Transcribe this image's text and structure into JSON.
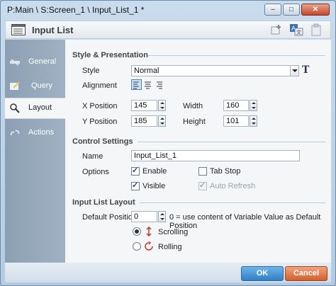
{
  "window": {
    "title": "P:Main \\ S:Screen_1 \\ Input_List_1 *"
  },
  "header": {
    "title": "Input List"
  },
  "sidebar": {
    "items": [
      {
        "label": "General",
        "icon": "general-icon"
      },
      {
        "label": "Layout",
        "icon": "layout-icon"
      },
      {
        "label": "Actions",
        "icon": "actions-icon"
      },
      {
        "label": "Query",
        "icon": "query-icon"
      }
    ],
    "selected": "Layout"
  },
  "style_presentation": {
    "section_title": "Style & Presentation",
    "style_label": "Style",
    "style_value": "Normal",
    "alignment_label": "Alignment",
    "x_label": "X Position",
    "x_value": "145",
    "y_label": "Y Position",
    "y_value": "185",
    "width_label": "Width",
    "width_value": "160",
    "height_label": "Height",
    "height_value": "101"
  },
  "control_settings": {
    "section_title": "Control Settings",
    "name_label": "Name",
    "name_value": "Input_List_1",
    "options_label": "Options",
    "enable_label": "Enable",
    "tabstop_label": "Tab Stop",
    "visible_label": "Visible",
    "autorefresh_label": "Auto Refresh"
  },
  "input_list_layout": {
    "section_title": "Input List Layout",
    "default_position_label": "Default Position",
    "default_position_value": "0",
    "hint": "0 = use content of Variable Value as Default Position",
    "scrolling_label": "Scrolling",
    "rolling_label": "Rolling"
  },
  "footer": {
    "ok_label": "OK",
    "cancel_label": "Cancel"
  },
  "colors": {
    "section_title": "#444444",
    "ok": "#2f7fc4",
    "cancel": "#d35e2c",
    "sidebar": "#8da0b3"
  }
}
